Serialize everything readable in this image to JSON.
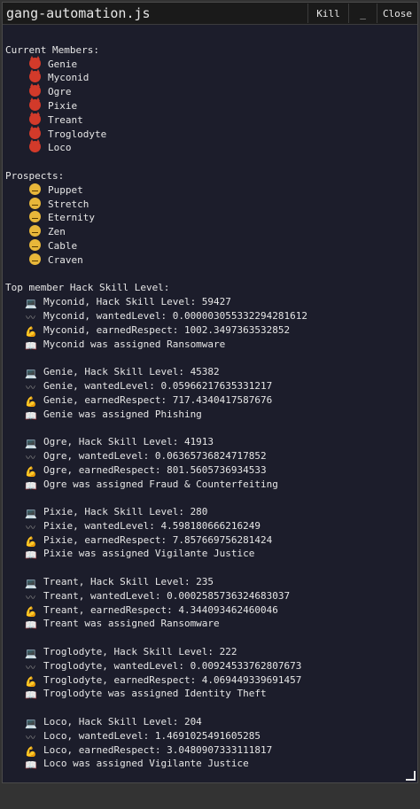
{
  "window": {
    "title": "gang-automation.js",
    "kill_label": "Kill",
    "minimize_label": "_",
    "close_label": "Close"
  },
  "members_header": "Current Members:",
  "members": [
    "Genie",
    "Myconid",
    "Ogre",
    "Pixie",
    "Treant",
    "Troglodyte",
    "Loco"
  ],
  "prospects_header": "Prospects:",
  "prospects": [
    "Puppet",
    "Stretch",
    "Eternity",
    "Zen",
    "Cable",
    "Craven"
  ],
  "top_header": "Top member Hack Skill Level:",
  "reports": [
    {
      "hack": "Myconid, Hack Skill Level: 59427",
      "wanted": "Myconid, wantedLevel: 0.00000305533229428161​2",
      "respect": "Myconid, earnedRespect: 1002.3497363532852",
      "assigned": "Myconid was assigned Ransomware"
    },
    {
      "hack": "Genie, Hack Skill Level: 45382",
      "wanted": "Genie, wantedLevel: 0.05966217635331217",
      "respect": "Genie, earnedRespect: 717.4340417587676",
      "assigned": "Genie was assigned Phishing"
    },
    {
      "hack": "Ogre, Hack Skill Level: 41913",
      "wanted": "Ogre, wantedLevel: 0.0636573682471785​2",
      "respect": "Ogre, earnedRespect: 801.5605736934533",
      "assigned": "Ogre was assigned Fraud & Counterfeiting"
    },
    {
      "hack": "Pixie, Hack Skill Level: 280",
      "wanted": "Pixie, wantedLevel: 4.598180666216249",
      "respect": "Pixie, earnedRespect: 7.857669756281424",
      "assigned": "Pixie was assigned Vigilante Justice"
    },
    {
      "hack": "Treant, Hack Skill Level: 235",
      "wanted": "Treant, wantedLevel: 0.0002585736324683037",
      "respect": "Treant, earnedRespect: 4.344093462460046",
      "assigned": "Treant was assigned Ransomware"
    },
    {
      "hack": "Troglodyte, Hack Skill Level: 222",
      "wanted": "Troglodyte, wantedLevel: 0.0092453376280767​3",
      "respect": "Troglodyte, earnedRespect: 4.06944933969145​7",
      "assigned": "Troglodyte was assigned Identity Theft"
    },
    {
      "hack": "Loco, Hack Skill Level: 204",
      "wanted": "Loco, wantedLevel: 1.4691025491605285",
      "respect": "Loco, earnedRespect: 3.0480907333111817",
      "assigned": "Loco was assigned Vigilante Justice"
    }
  ],
  "icons": {
    "member": "devil-face-icon",
    "prospect": "neutral-face-icon",
    "hack": "laptop-icon",
    "wanted": "wavy-dash-icon",
    "respect": "flexed-biceps-icon",
    "assigned": "open-book-icon"
  },
  "colors": {
    "background": "#1c1d2b",
    "text": "#e6e6e6",
    "titlebar": "#1a1a1a"
  }
}
